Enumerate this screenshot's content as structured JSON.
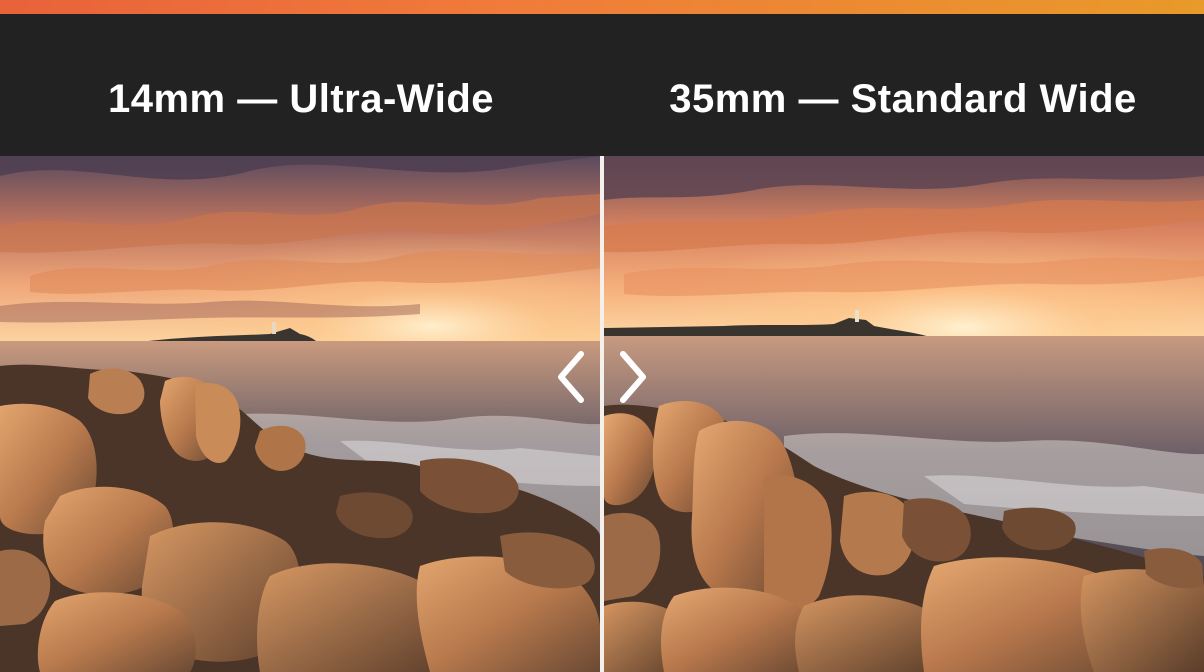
{
  "captions": {
    "left": "14mm — Ultra-Wide",
    "right": "35mm — Standard Wide"
  },
  "colors": {
    "accent_start": "#e8623a",
    "accent_end": "#e89a2a",
    "header_bg": "#222222",
    "caption_text": "#ffffff",
    "divider": "#f4f1ec"
  },
  "icons": {
    "slider_left": "chevron-left-icon",
    "slider_right": "chevron-right-icon"
  }
}
